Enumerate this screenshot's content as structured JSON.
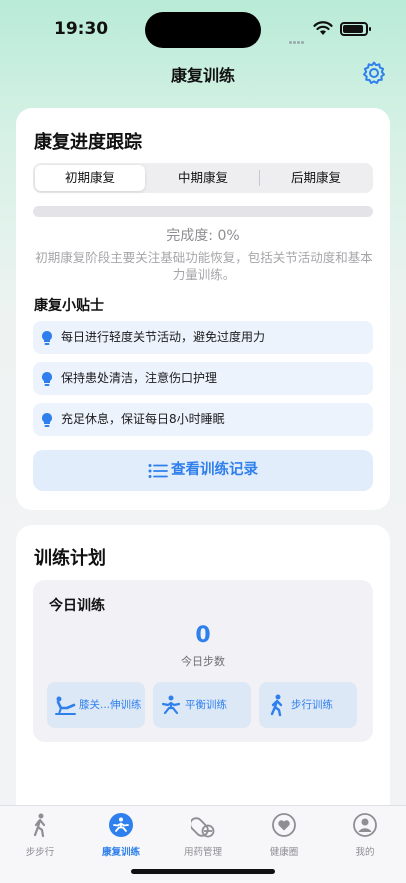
{
  "status": {
    "time": "19:30"
  },
  "nav": {
    "title": "康复训练",
    "settings_icon": "gear-icon"
  },
  "progress_card": {
    "title": "康复进度跟踪",
    "segments": [
      {
        "label": "初期康复",
        "selected": true
      },
      {
        "label": "中期康复",
        "selected": false
      },
      {
        "label": "后期康复",
        "selected": false
      }
    ],
    "progress_fraction": 0,
    "progress_text": "完成度: 0%",
    "stage_description": "初期康复阶段主要关注基础功能恢复，包括关节活动度和基本力量训练。",
    "tips_title": "康复小贴士",
    "tips": [
      {
        "icon": "lightbulb-icon",
        "text": "每日进行轻度关节活动，避免过度用力"
      },
      {
        "icon": "lightbulb-icon",
        "text": "保持患处清洁，注意伤口护理"
      },
      {
        "icon": "lightbulb-icon",
        "text": "充足休息，保证每日8小时睡眠"
      }
    ],
    "records_button": {
      "icon": "list-icon",
      "label": "查看训练记录"
    }
  },
  "plan_card": {
    "title": "训练计划",
    "today": {
      "title": "今日训练",
      "steps_value": "0",
      "steps_label": "今日步数",
      "buttons": [
        {
          "icon": "knee-stretch-icon",
          "label": "膝关...伸训练"
        },
        {
          "icon": "balance-icon",
          "label": "平衡训练"
        },
        {
          "icon": "walking-icon",
          "label": "步行训练"
        }
      ]
    }
  },
  "tab_bar": {
    "items": [
      {
        "icon": "walking-icon",
        "label": "步步行",
        "active": false
      },
      {
        "icon": "rehab-icon",
        "label": "康复训练",
        "active": true
      },
      {
        "icon": "pill-icon",
        "label": "用药管理",
        "active": false
      },
      {
        "icon": "heart-icon",
        "label": "健康圈",
        "active": false
      },
      {
        "icon": "person-icon",
        "label": "我的",
        "active": false
      }
    ]
  },
  "colors": {
    "accent": "#2f80ed",
    "tip_bg": "#edf3fc",
    "inactive": "#8e8e93"
  }
}
